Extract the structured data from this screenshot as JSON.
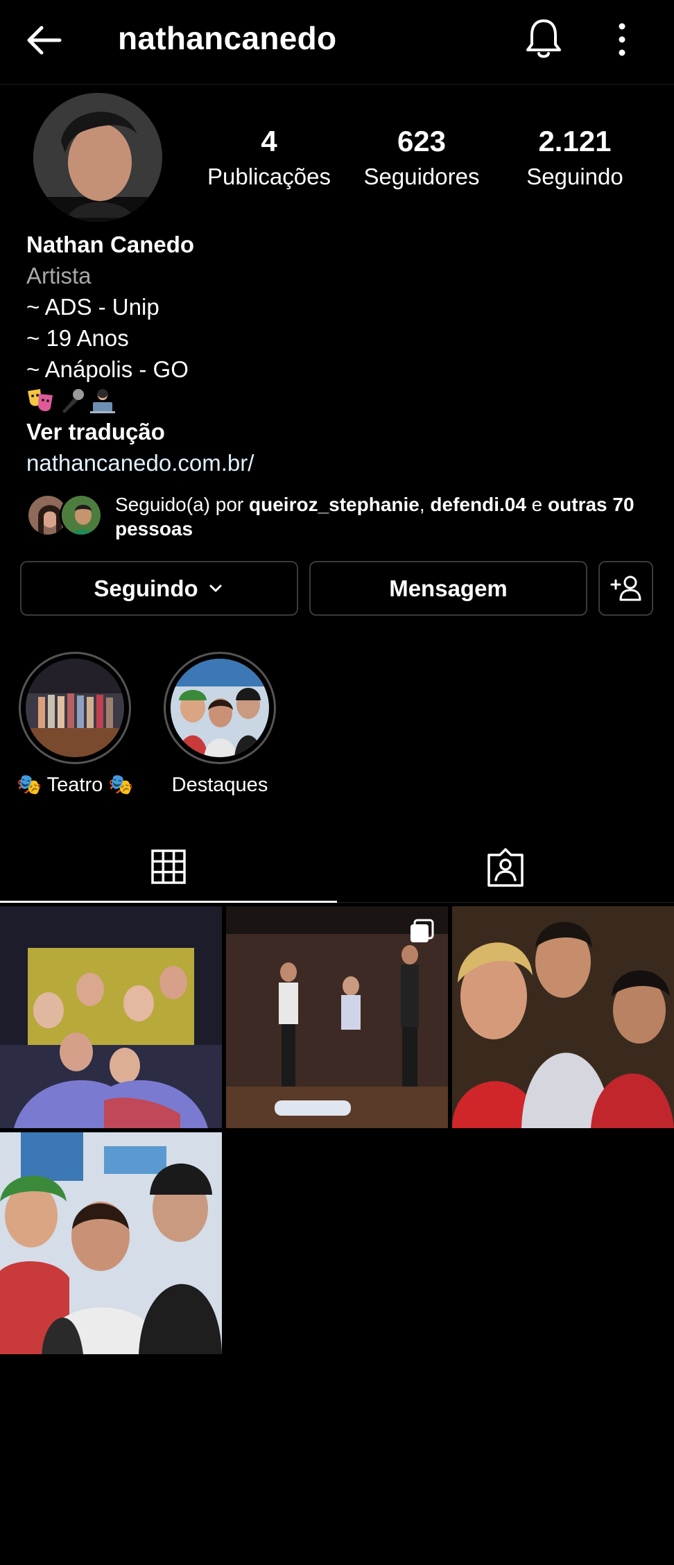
{
  "header": {
    "username": "nathancanedo"
  },
  "stats": {
    "posts": {
      "value": "4",
      "label": "Publicações"
    },
    "followers": {
      "value": "623",
      "label": "Seguidores"
    },
    "following": {
      "value": "2.121",
      "label": "Seguindo"
    }
  },
  "bio": {
    "name": "Nathan Canedo",
    "category": "Artista",
    "lines": [
      "~ ADS - Unip",
      "~ 19 Anos",
      "~ Anápolis - GO"
    ],
    "translate_label": "Ver tradução",
    "link": "nathancanedo.com.br/"
  },
  "followed_by": {
    "prefix": "Seguido(a) por ",
    "user1": "queiroz_stephanie",
    "separator": ", ",
    "user2": "defendi.04",
    "conjunction": " e ",
    "others": "outras 70 pessoas"
  },
  "actions": {
    "following_label": "Seguindo",
    "message_label": "Mensagem"
  },
  "highlights": [
    {
      "label": "🎭 Teatro 🎭"
    },
    {
      "label": "Destaques"
    }
  ],
  "tabs": {
    "active": "grid",
    "items": [
      "posts-grid-icon",
      "tagged-icon"
    ]
  },
  "posts": {
    "count": 4
  },
  "colors": {
    "background": "#000000",
    "text": "#ffffff",
    "secondary": "#a8a8a8",
    "border": "#3a3a3a",
    "link": "#e0f1ff"
  }
}
